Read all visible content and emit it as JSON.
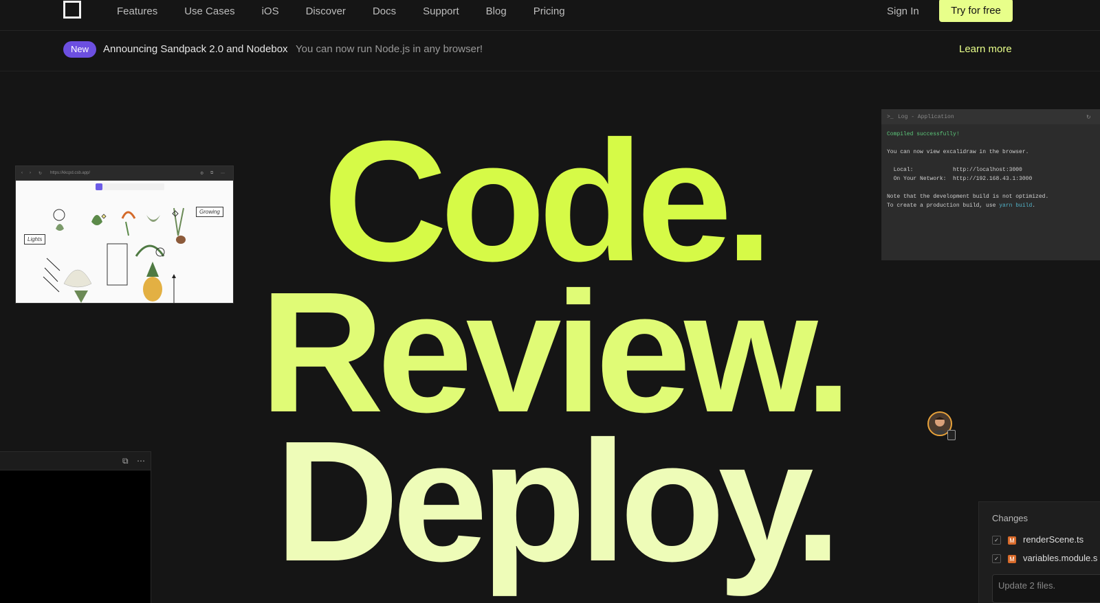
{
  "nav": {
    "links": [
      "Features",
      "Use Cases",
      "iOS",
      "Discover",
      "Docs",
      "Support",
      "Blog",
      "Pricing"
    ],
    "sign_in": "Sign In",
    "cta": "Try for free"
  },
  "announcement": {
    "badge": "New",
    "title": "Announcing Sandpack 2.0 and Nodebox",
    "subtitle": "You can now run Node.js in any browser!",
    "link": "Learn more"
  },
  "hero": {
    "line1": "Code.",
    "line2": "Review.",
    "line3": "Deploy."
  },
  "browser_card": {
    "url": "https://kkcpd.csb.app/",
    "labels": [
      "Growing",
      "Lights"
    ]
  },
  "terminal": {
    "title": "Log - Application",
    "compiled": "Compiled successfully!",
    "view_line": "You can now view excalidraw in the browser.",
    "local_label": "Local:",
    "local_url": "http://localhost:3000",
    "network_label": "On Your Network:",
    "network_url": "http://192.168.43.1:3000",
    "note1": "Note that the development build is not optimized.",
    "note2_prefix": "To create a production build, use ",
    "note2_cmd": "yarn build",
    "note2_suffix": "."
  },
  "changes": {
    "title": "Changes",
    "files": [
      {
        "badge": "M",
        "name": "renderScene.ts"
      },
      {
        "badge": "M",
        "name": "variables.module.s"
      }
    ],
    "commit_placeholder": "Update 2 files."
  },
  "colors": {
    "accent": "#d6fa47",
    "badge": "#6c4fe0",
    "cta_bg": "#e8ff8a"
  }
}
